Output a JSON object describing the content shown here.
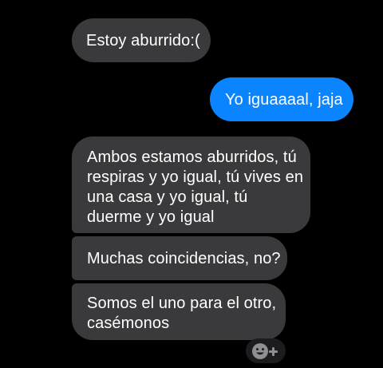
{
  "messages": [
    {
      "direction": "incoming",
      "lines": [
        "Estoy aburrido:("
      ]
    },
    {
      "direction": "outgoing",
      "lines": [
        "Yo iguaaaal, jaja"
      ]
    },
    {
      "direction": "incoming",
      "lines": [
        "Ambos estamos aburridos, tú",
        "respiras y yo igual, tú vives en",
        "una casa y yo igual, tú",
        "duerme y yo igual"
      ]
    },
    {
      "direction": "incoming",
      "lines": [
        "Muchas coincidencias, no?"
      ]
    },
    {
      "direction": "incoming",
      "lines": [
        "Somos el uno para el otro,",
        "casémonos"
      ]
    }
  ],
  "reaction_button": {
    "icon": "smiley-add-icon"
  },
  "colors": {
    "background": "#000000",
    "incoming_bubble": "#3a3a3c",
    "outgoing_bubble": "#0a84ff",
    "text": "#ffffff"
  }
}
